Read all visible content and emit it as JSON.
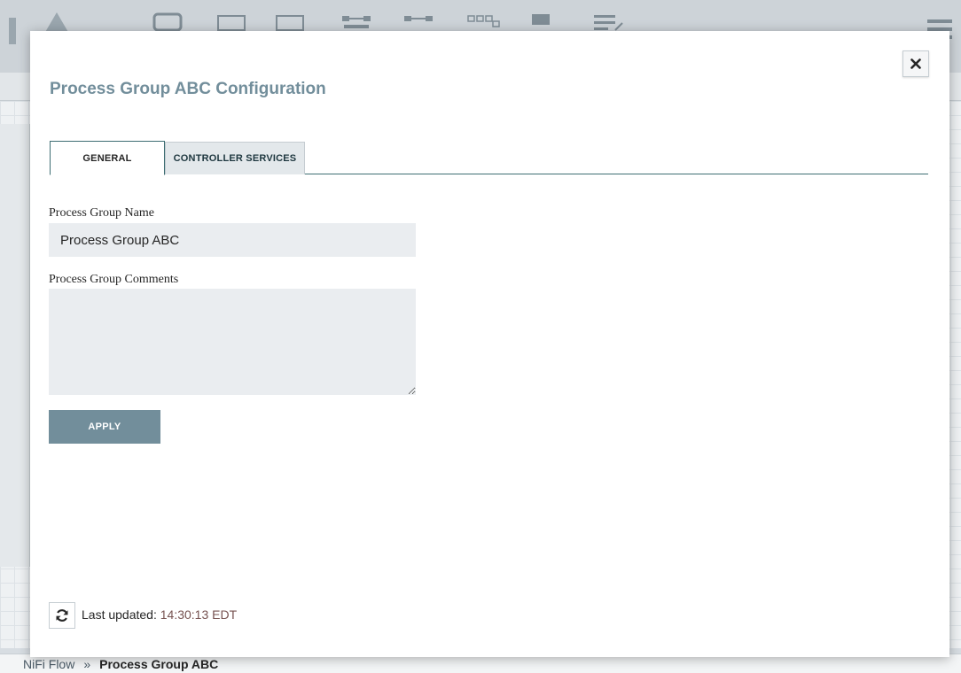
{
  "background": {
    "breadcrumbs": [
      "NiFi Flow",
      "Process Group ABC"
    ],
    "breadcrumb_separator": "»"
  },
  "dialog": {
    "title": "Process Group ABC Configuration",
    "close_icon": "close-icon",
    "tabs": [
      {
        "label": "GENERAL",
        "active": true
      },
      {
        "label": "CONTROLLER SERVICES",
        "active": false
      }
    ],
    "general": {
      "name_label": "Process Group Name",
      "name_value": "Process Group ABC",
      "comments_label": "Process Group Comments",
      "comments_value": "",
      "apply_label": "APPLY"
    },
    "footer": {
      "refresh_icon": "refresh-icon",
      "last_updated_label": "Last updated:",
      "last_updated_time": "14:30:13 EDT"
    }
  },
  "colors": {
    "title": "#728e9b",
    "accent": "#728e9b",
    "tab_border": "#3e6e73",
    "input_bg": "#eaedf0",
    "timestamp": "#775351"
  }
}
